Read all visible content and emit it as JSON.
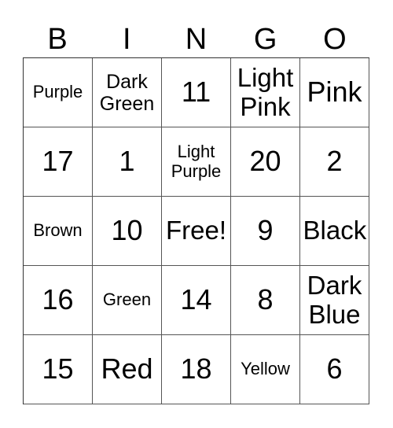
{
  "header": [
    "B",
    "I",
    "N",
    "G",
    "O"
  ],
  "cells": [
    [
      "Purple",
      "Dark Green",
      "11",
      "Light Pink",
      "Pink"
    ],
    [
      "17",
      "1",
      "Light Purple",
      "20",
      "2"
    ],
    [
      "Brown",
      "10",
      "Free!",
      "9",
      "Black"
    ],
    [
      "16",
      "Green",
      "14",
      "8",
      "Dark Blue"
    ],
    [
      "15",
      "Red",
      "18",
      "Yellow",
      "6"
    ]
  ]
}
